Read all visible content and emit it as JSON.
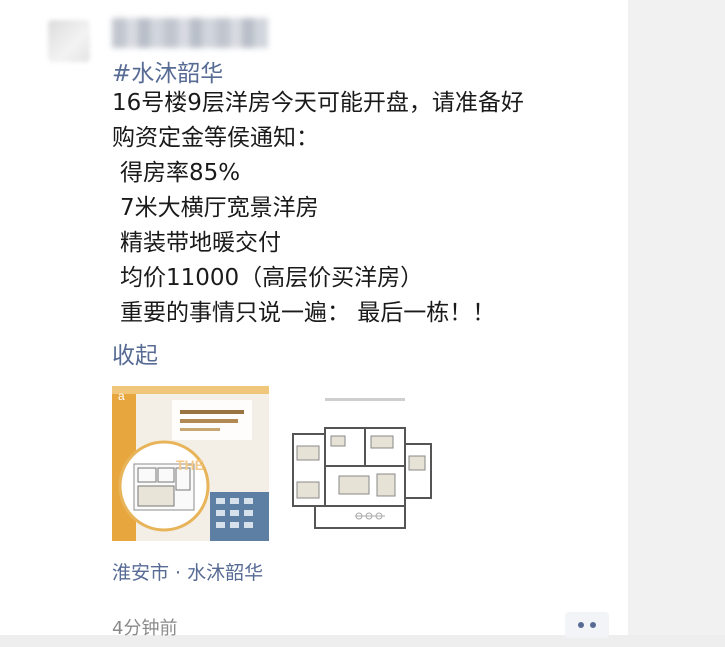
{
  "post": {
    "topic": "#水沐韶华",
    "lines": [
      "16号楼9层洋房今天可能开盘，请准备好",
      "购资定金等侯通知：",
      "得房率85%",
      "7米大横厅宽景洋房",
      "精装带地暖交付",
      "均价11000（高层价买洋房）",
      "重要的事情只说一遍：  最后一栋！！"
    ],
    "collapse_label": "收起",
    "location": "淮安市 · 水沐韶华",
    "time": "4分钟前"
  },
  "photos": {
    "photo1_caption_line1": "",
    "photo1_brand": "THE",
    "photo1_mark": "a"
  },
  "colors": {
    "link": "#576b95",
    "text": "#1a1a1a",
    "meta": "#8a8a8a",
    "accent_gold": "#e0a53f"
  }
}
